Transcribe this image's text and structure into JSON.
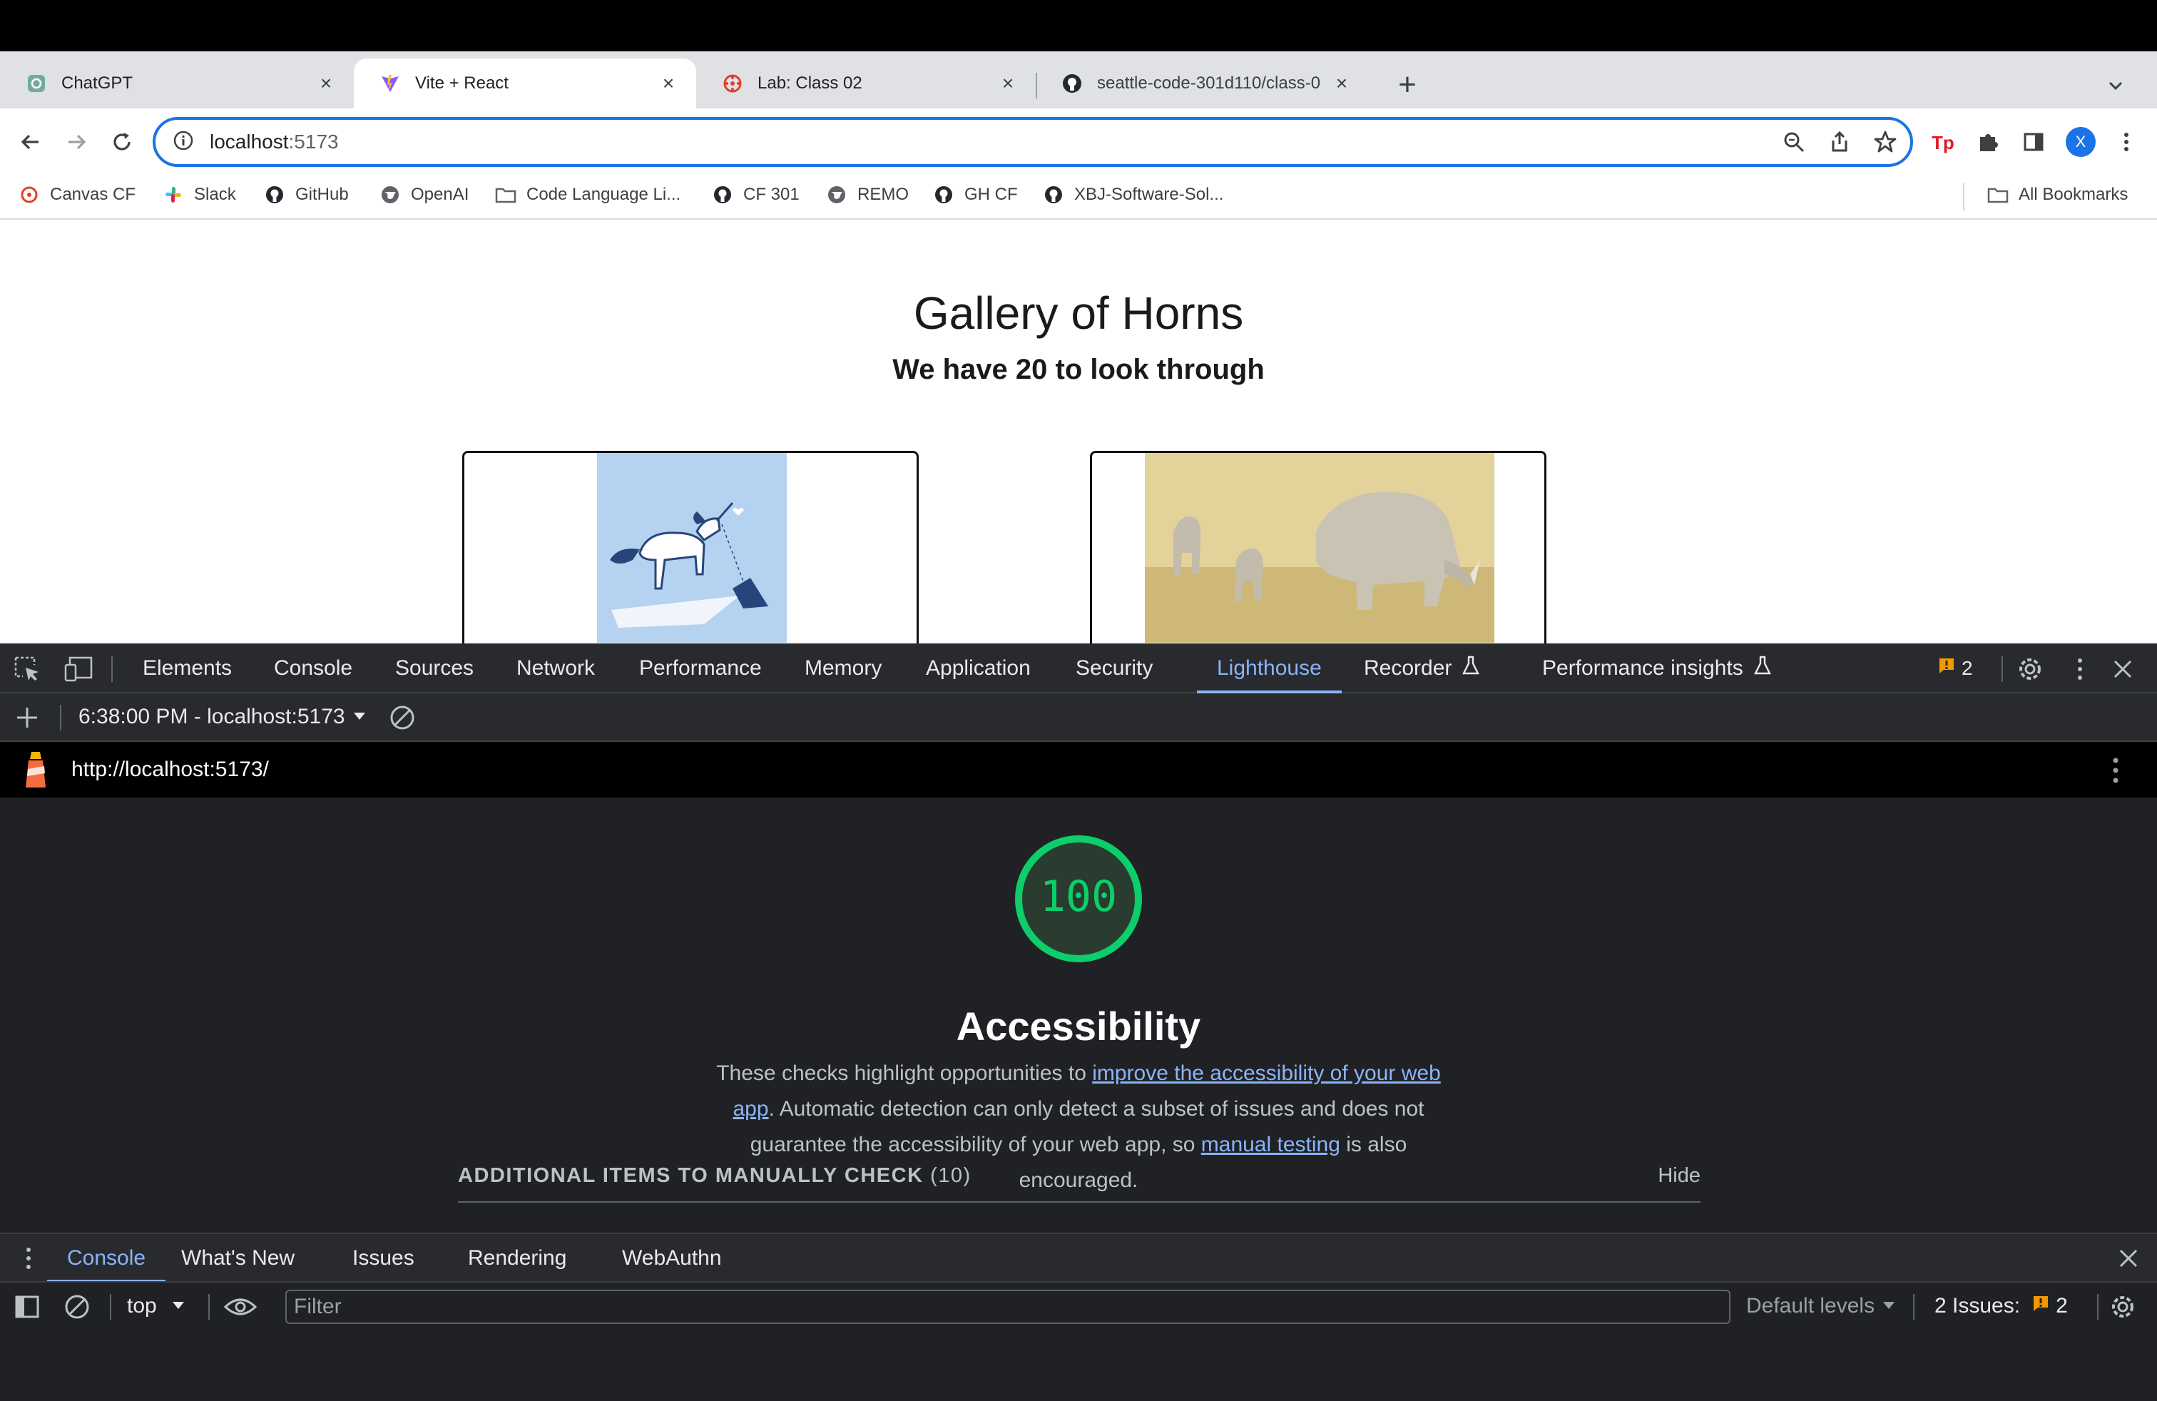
{
  "browser": {
    "tabs": [
      {
        "label": "ChatGPT",
        "icon": "chatgpt-icon",
        "active": false
      },
      {
        "label": "Vite + React",
        "icon": "vite-icon",
        "active": true
      },
      {
        "label": "Lab: Class 02",
        "icon": "canvas-icon",
        "active": false
      },
      {
        "label": "seattle-code-301d110/class-0",
        "icon": "github-icon",
        "active": false
      }
    ],
    "address": {
      "host": "localhost",
      "port": ":5173"
    },
    "profile_initial": "X",
    "bookmarks": [
      {
        "label": "Canvas CF",
        "icon": "canvas-icon"
      },
      {
        "label": "Slack",
        "icon": "slack-icon"
      },
      {
        "label": "GitHub",
        "icon": "github-icon"
      },
      {
        "label": "OpenAI",
        "icon": "globe-icon"
      },
      {
        "label": "Code Language Li...",
        "icon": "folder-icon"
      },
      {
        "label": "CF 301",
        "icon": "github-icon"
      },
      {
        "label": "REMO",
        "icon": "globe-icon"
      },
      {
        "label": "GH CF",
        "icon": "github-icon"
      },
      {
        "label": "XBJ-Software-Sol...",
        "icon": "github-icon"
      }
    ],
    "all_bookmarks": "All Bookmarks"
  },
  "page": {
    "title": "Gallery of Horns",
    "subtitle": "We have 20 to look through"
  },
  "devtools": {
    "tabs": [
      "Elements",
      "Console",
      "Sources",
      "Network",
      "Performance",
      "Memory",
      "Application",
      "Security",
      "Lighthouse",
      "Recorder",
      "Performance insights"
    ],
    "active_tab": "Lighthouse",
    "issues_badge": "2",
    "report_selector": "6:38:00 PM - localhost:5173",
    "report_url": "http://localhost:5173/",
    "score": "100",
    "category": "Accessibility",
    "description": {
      "p1": "These checks highlight opportunities to ",
      "link1": "improve the accessibility of your web app",
      "p2": ". Automatic detection can only detect a subset of issues and does not guarantee the accessibility of your web app, so ",
      "link2": "manual testing",
      "p3": " is also encouraged."
    },
    "manual_check": {
      "title": "ADDITIONAL ITEMS TO MANUALLY CHECK",
      "count": "(10)",
      "toggle": "Hide"
    },
    "drawer": {
      "tabs": [
        "Console",
        "What's New",
        "Issues",
        "Rendering",
        "WebAuthn"
      ],
      "active_tab": "Console",
      "context": "top",
      "filter_placeholder": "Filter",
      "levels": "Default levels",
      "issues_label": "2 Issues:",
      "issues_count": "2"
    },
    "colors": {
      "accent": "#8ab4f8",
      "score_green": "#0cce6b",
      "issue_orange": "#f29900"
    }
  }
}
